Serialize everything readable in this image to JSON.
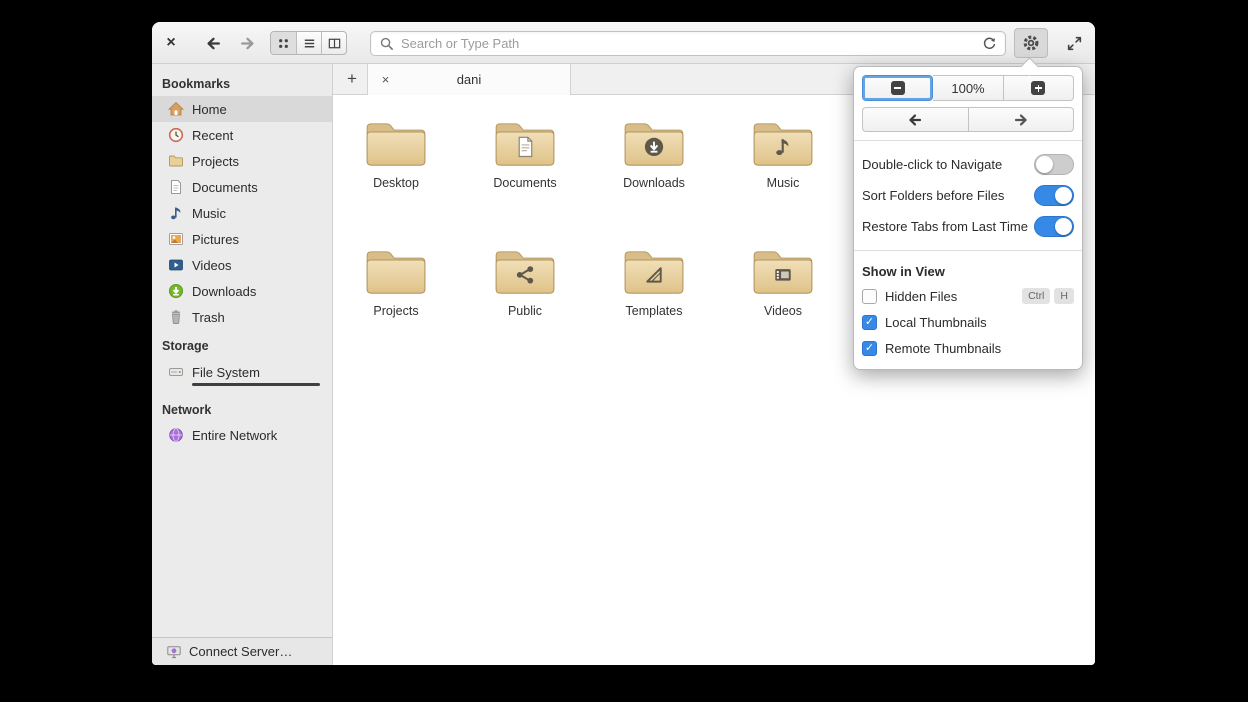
{
  "headerbar": {
    "close_glyph": "×",
    "search": {
      "placeholder": "Search or Type Path"
    },
    "view_modes": [
      "grid",
      "list",
      "columns"
    ]
  },
  "tabbar": {
    "new_tab_glyph": "+",
    "tabs": [
      {
        "label": "dani",
        "close_glyph": "×",
        "active": true
      }
    ]
  },
  "sidebar": {
    "bookmarks_title": "Bookmarks",
    "bookmarks": [
      {
        "label": "Home",
        "icon": "home-icon",
        "selected": true
      },
      {
        "label": "Recent",
        "icon": "recent-icon",
        "selected": false
      },
      {
        "label": "Projects",
        "icon": "folder-icon",
        "selected": false
      },
      {
        "label": "Documents",
        "icon": "document-icon",
        "selected": false
      },
      {
        "label": "Music",
        "icon": "music-icon",
        "selected": false
      },
      {
        "label": "Pictures",
        "icon": "pictures-icon",
        "selected": false
      },
      {
        "label": "Videos",
        "icon": "videos-icon",
        "selected": false
      },
      {
        "label": "Downloads",
        "icon": "downloads-icon",
        "selected": false
      },
      {
        "label": "Trash",
        "icon": "trash-icon",
        "selected": false
      }
    ],
    "storage_title": "Storage",
    "storage": [
      {
        "label": "File System",
        "icon": "drive-icon",
        "usage_bar": true
      }
    ],
    "network_title": "Network",
    "network": [
      {
        "label": "Entire Network",
        "icon": "network-icon"
      }
    ],
    "connect_server_label": "Connect Server…"
  },
  "files": {
    "items": [
      {
        "label": "Desktop",
        "emblem": "none"
      },
      {
        "label": "Documents",
        "emblem": "page"
      },
      {
        "label": "Downloads",
        "emblem": "download"
      },
      {
        "label": "Music",
        "emblem": "music"
      },
      {
        "label": "Projects",
        "emblem": "none"
      },
      {
        "label": "Public",
        "emblem": "share"
      },
      {
        "label": "Templates",
        "emblem": "template"
      },
      {
        "label": "Videos",
        "emblem": "video"
      }
    ]
  },
  "popover": {
    "zoom": {
      "level": "100%"
    },
    "toggles": [
      {
        "label": "Double-click to Navigate",
        "on": false
      },
      {
        "label": "Sort Folders before Files",
        "on": true
      },
      {
        "label": "Restore Tabs from Last Time",
        "on": true
      }
    ],
    "show_in_view_title": "Show in View",
    "view_options": [
      {
        "label": "Hidden Files",
        "checked": false,
        "shortcut": [
          "Ctrl",
          "H"
        ]
      },
      {
        "label": "Local Thumbnails",
        "checked": true
      },
      {
        "label": "Remote Thumbnails",
        "checked": true
      }
    ],
    "check_glyph": "✓"
  },
  "colors": {
    "accent": "#3689e6",
    "folder": "#e8d2a0",
    "selection": "#d9d9d9"
  }
}
